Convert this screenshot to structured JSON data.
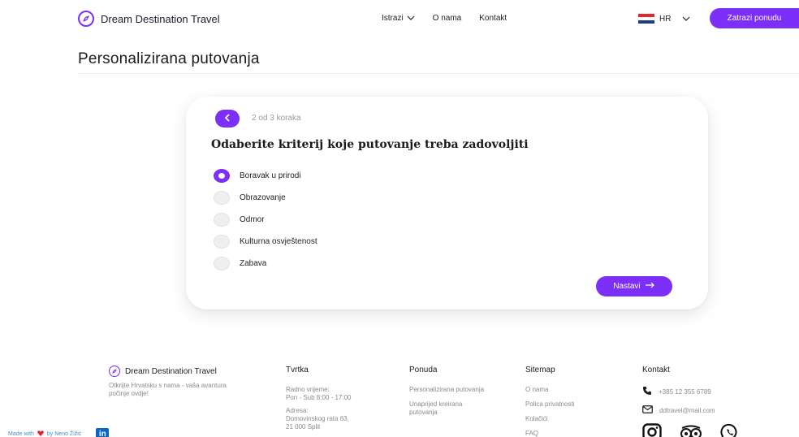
{
  "header": {
    "brand": "Dream Destination Travel",
    "nav": [
      {
        "label": "Istrazi",
        "dropdown": true
      },
      {
        "label": "O nama",
        "dropdown": false
      },
      {
        "label": "Kontakt",
        "dropdown": false
      }
    ],
    "language": "HR",
    "quote_button": "Zatrazi ponudu"
  },
  "page_title": "Personalizirana putovanja",
  "wizard": {
    "step_text": "2 od 3 koraka",
    "question": "Odaberite kriterij koje putovanje treba zadovoljiti",
    "options": [
      {
        "label": "Boravak u prirodi",
        "selected": true
      },
      {
        "label": "Obrazovanje",
        "selected": false
      },
      {
        "label": "Odmor",
        "selected": false
      },
      {
        "label": "Kulturna osvještenost",
        "selected": false
      },
      {
        "label": "Zabava",
        "selected": false
      }
    ],
    "next_button": "Nastavi"
  },
  "footer": {
    "brand": "Dream Destination Travel",
    "tagline": "Otkrijte Hrvatsku s nama - vaša avantura počinje ovdje!",
    "company": {
      "heading": "Tvrtka",
      "hours_label": "Radno vrijeme:",
      "hours": "Pon - Sub 8:00 - 17:00",
      "address_label": "Adresa:",
      "address_line1": "Domovinskog rata 63,",
      "address_line2": "21 000 Split"
    },
    "offer": {
      "heading": "Ponuda",
      "links": [
        "Personalizirana putovanja",
        "Unaprijed kreirana putovanja"
      ]
    },
    "sitemap": {
      "heading": "Sitemap",
      "links": [
        "O nama",
        "Polica privatnosti",
        "Kolačići",
        "FAQ"
      ]
    },
    "contact": {
      "heading": "Kontakt",
      "phone": "+385 12 355 6789",
      "email": "ddtravel@mail.com"
    }
  },
  "made_with": {
    "prefix": "Made with",
    "suffix": "by Neno Žižić",
    "linkedin": "in"
  },
  "colors": {
    "accent": "#7b2ff7",
    "flag_red": "#e3252e",
    "flag_white": "#ffffff",
    "flag_blue": "#1d3a8f",
    "heart": "#e0202f",
    "linkedin": "#0a66c2"
  },
  "icons": [
    "compass-icon",
    "chevron-down-icon",
    "arrow-left-icon",
    "arrow-right-icon",
    "phone-icon",
    "mail-icon",
    "instagram-icon",
    "tripadvisor-icon",
    "whatsapp-icon",
    "heart-icon",
    "linkedin-icon"
  ]
}
